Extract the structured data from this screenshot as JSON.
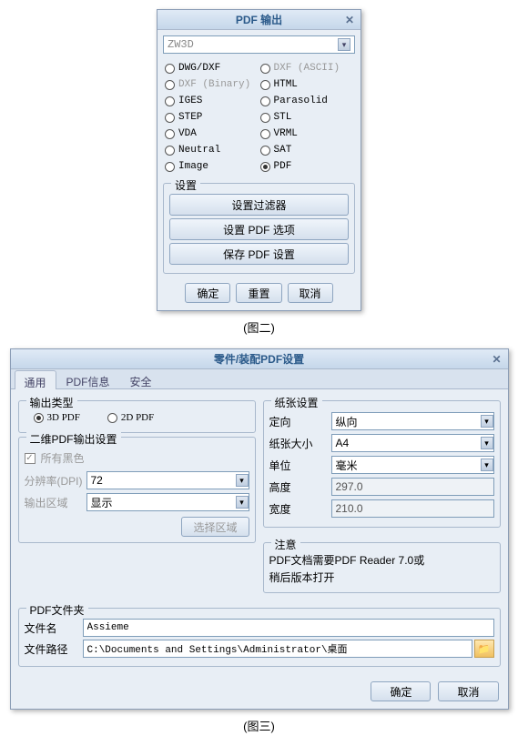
{
  "win1": {
    "title": "PDF 输出",
    "format_dropdown": "ZW3D",
    "formats": [
      {
        "label": "DWG/DXF",
        "checked": false,
        "gray": false
      },
      {
        "label": "DXF (ASCII)",
        "checked": false,
        "gray": true
      },
      {
        "label": "DXF (Binary)",
        "checked": false,
        "gray": true
      },
      {
        "label": "HTML",
        "checked": false,
        "gray": false
      },
      {
        "label": "IGES",
        "checked": false,
        "gray": false
      },
      {
        "label": "Parasolid",
        "checked": false,
        "gray": false
      },
      {
        "label": "STEP",
        "checked": false,
        "gray": false
      },
      {
        "label": "STL",
        "checked": false,
        "gray": false
      },
      {
        "label": "VDA",
        "checked": false,
        "gray": false
      },
      {
        "label": "VRML",
        "checked": false,
        "gray": false
      },
      {
        "label": "Neutral",
        "checked": false,
        "gray": false
      },
      {
        "label": "SAT",
        "checked": false,
        "gray": false
      },
      {
        "label": "Image",
        "checked": false,
        "gray": false
      },
      {
        "label": "PDF",
        "checked": true,
        "gray": false
      }
    ],
    "settings_legend": "设置",
    "btn_filter": "设置过滤器",
    "btn_options": "设置 PDF 选项",
    "btn_save": "保存 PDF 设置",
    "ok": "确定",
    "reset": "重置",
    "cancel": "取消"
  },
  "caption1": "(图二)",
  "win2": {
    "title": "零件/装配PDF设置",
    "tabs": {
      "general": "通用",
      "pdfinfo": "PDF信息",
      "security": "安全"
    },
    "output": {
      "legend": "输出类型",
      "opt3d": "3D PDF",
      "opt2d": "2D PDF"
    },
    "twod": {
      "legend": "二维PDF输出设置",
      "all_black": "所有黑色",
      "dpi_label": "分辨率(DPI)",
      "dpi_value": "72",
      "area_label": "输出区域",
      "area_value": "显示",
      "select_area": "选择区域"
    },
    "paper": {
      "legend": "纸张设置",
      "orient_label": "定向",
      "orient_value": "纵向",
      "size_label": "纸张大小",
      "size_value": "A4",
      "unit_label": "单位",
      "unit_value": "毫米",
      "height_label": "高度",
      "height_value": "297.0",
      "width_label": "宽度",
      "width_value": "210.0"
    },
    "note": {
      "legend": "注意",
      "line1": "PDF文档需要PDF Reader 7.0或",
      "line2": "稍后版本打开"
    },
    "folder": {
      "legend": "PDF文件夹",
      "name_label": "文件名",
      "name_value": "Assieme",
      "path_label": "文件路径",
      "path_value": "C:\\Documents and Settings\\Administrator\\桌面"
    },
    "ok": "确定",
    "cancel": "取消"
  },
  "caption2": "(图三)"
}
